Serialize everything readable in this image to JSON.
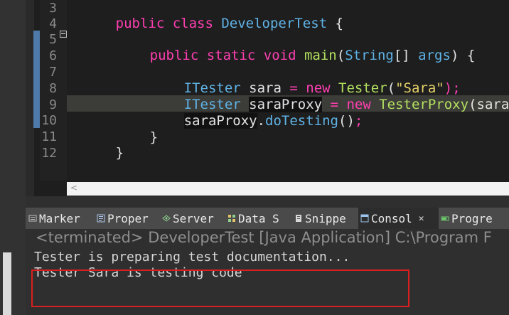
{
  "editor": {
    "line_numbers": [
      "3",
      "4",
      "5",
      "6",
      "7",
      "8",
      "9",
      "10",
      "11",
      "12"
    ],
    "code": {
      "l3": [
        "public class ",
        "DeveloperTest",
        " {"
      ],
      "l5": [
        "public static void ",
        "main",
        "(",
        "String",
        "[] ",
        "args",
        ") {"
      ],
      "l7": [
        "ITester",
        " sara ",
        "=",
        " new ",
        "Tester",
        "(",
        "\"Sara\"",
        ");"
      ],
      "l8": [
        "ITester",
        " ",
        "saraProxy",
        " ",
        "=",
        " new ",
        "TesterProxy",
        "(sara);"
      ],
      "l9": [
        "saraProxy",
        ".",
        "doTesting",
        "()",
        ";"
      ],
      "l10": [
        "}"
      ],
      "l11": [
        "}"
      ]
    },
    "hscroll_arrow": "<"
  },
  "views": {
    "tabs": [
      {
        "label": "Marker",
        "icon": "markers-icon",
        "color": "#c0c0c0"
      },
      {
        "label": "Proper",
        "icon": "properties-icon",
        "color": "#a9c4e8"
      },
      {
        "label": "Server",
        "icon": "servers-icon",
        "color": "#8fd08f"
      },
      {
        "label": "Data S",
        "icon": "datasource-icon",
        "color": "#e0c36a"
      },
      {
        "label": "Snippe",
        "icon": "snippets-icon",
        "color": "#d8d8d8"
      },
      {
        "label": "Consol",
        "icon": "console-icon",
        "color": "#9cc2ea"
      },
      {
        "label": "Progre",
        "icon": "progress-icon",
        "color": "#6fcf6f"
      }
    ],
    "close_glyph": "✕"
  },
  "console": {
    "terminated": "<terminated> DeveloperTest [Java Application] C:\\Program F",
    "output": [
      "Tester is preparing test documentation...",
      "Tester Sara is testing code"
    ],
    "highlight_color": "#d91f1f"
  }
}
